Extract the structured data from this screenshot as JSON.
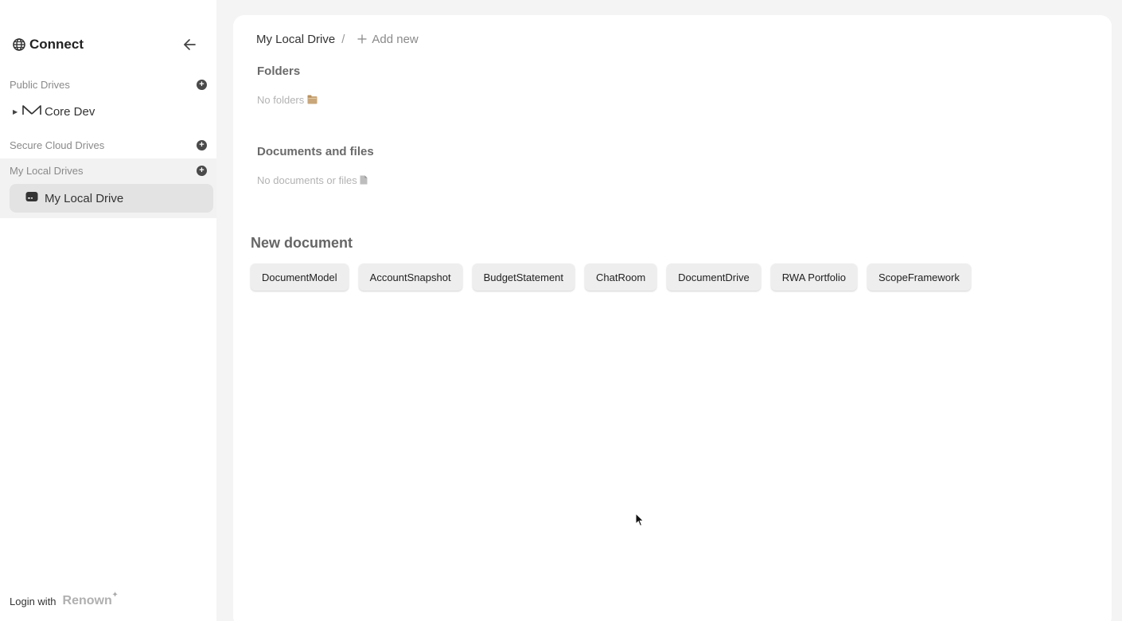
{
  "sidebar": {
    "brand": "Connect",
    "sections": {
      "public": {
        "label": "Public Drives"
      },
      "cloud": {
        "label": "Secure Cloud Drives"
      },
      "local": {
        "label": "My Local Drives"
      }
    },
    "public_drive": {
      "label": "Core Dev"
    },
    "local_drive": {
      "label": "My Local Drive"
    },
    "login": {
      "prefix": "Login with",
      "provider": "Renown"
    }
  },
  "main": {
    "breadcrumb": {
      "current": "My Local Drive",
      "separator": "/",
      "add_new": "Add new"
    },
    "folders": {
      "title": "Folders",
      "empty": "No folders"
    },
    "documents": {
      "title": "Documents and files",
      "empty": "No documents or files"
    },
    "new_document": {
      "title": "New document",
      "types": [
        "DocumentModel",
        "AccountSnapshot",
        "BudgetStatement",
        "ChatRoom",
        "DocumentDrive",
        "RWA Portfolio",
        "ScopeFramework"
      ]
    }
  },
  "icons": {
    "brand": "globe-icon",
    "collapse": "arrow-left-icon",
    "add": "plus-circle-icon",
    "drive": "hard-drive-icon",
    "folder": "folder-emoji-icon",
    "file": "document-emoji-icon"
  }
}
